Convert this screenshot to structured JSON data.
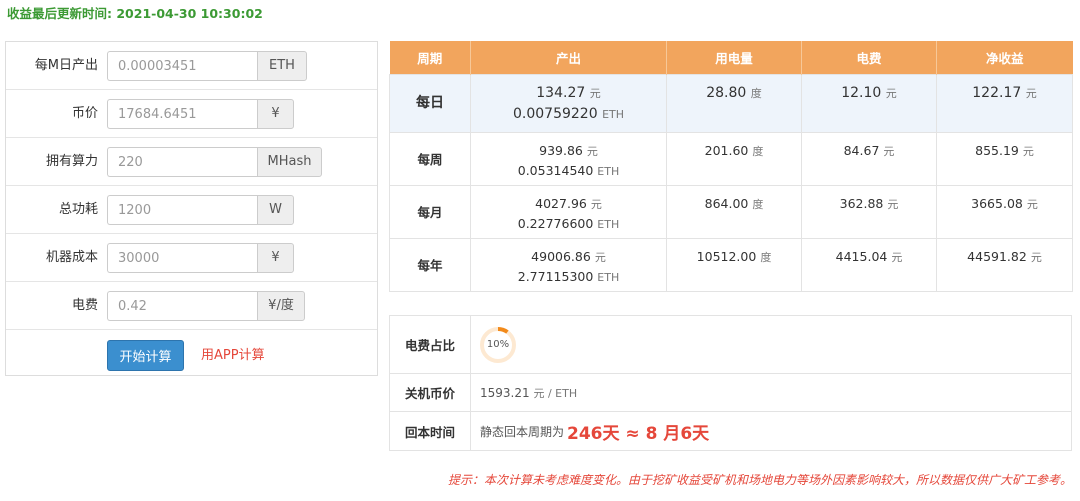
{
  "update": {
    "text": "收益最后更新时间: 2021-04-30 10:30:02"
  },
  "form": {
    "fields": [
      {
        "label": "每M日产出",
        "value": "0.00003451",
        "unit": "ETH"
      },
      {
        "label": "币价",
        "value": "17684.6451",
        "unit": "¥"
      },
      {
        "label": "拥有算力",
        "value": "220",
        "unit": "MHash"
      },
      {
        "label": "总功耗",
        "value": "1200",
        "unit": "W"
      },
      {
        "label": "机器成本",
        "value": "30000",
        "unit": "¥"
      },
      {
        "label": "电费",
        "value": "0.42",
        "unit": "¥/度"
      }
    ],
    "calc_button": "开始计算",
    "app_link": "用APP计算"
  },
  "table": {
    "headers": [
      "周期",
      "产出",
      "用电量",
      "电费",
      "净收益"
    ],
    "rows": [
      {
        "period": "每日",
        "cny": "134.27",
        "eth": "0.00759220",
        "power": "28.80",
        "fee": "12.10",
        "net": "122.17"
      },
      {
        "period": "每周",
        "cny": "939.86",
        "eth": "0.05314540",
        "power": "201.60",
        "fee": "84.67",
        "net": "855.19"
      },
      {
        "period": "每月",
        "cny": "4027.96",
        "eth": "0.22776600",
        "power": "864.00",
        "fee": "362.88",
        "net": "3665.08"
      },
      {
        "period": "每年",
        "cny": "49006.86",
        "eth": "2.77115300",
        "power": "10512.00",
        "fee": "4415.04",
        "net": "44591.82"
      }
    ],
    "units": {
      "yuan": "元",
      "eth": "ETH",
      "du": "度"
    }
  },
  "summary": {
    "ratio_label": "电费占比",
    "ratio_value": "10%",
    "ratio_fraction": 0.1,
    "shutdown_label": "关机币价",
    "shutdown_value": "1593.21",
    "shutdown_unit": "元 / ETH",
    "payback_label": "回本时间",
    "payback_prefix": "静态回本周期为",
    "payback_value": "246天 ≈ 8 月6天"
  },
  "tip": "提示：本次计算未考虑难度变化。由于挖矿收益受矿机和场地电力等场外因素影响较大，所以数据仅供广大矿工参考。",
  "colors": {
    "header": "#f2a55d",
    "accent_red": "#e5473a",
    "green": "#3c9a34",
    "button": "#3b8fcf"
  }
}
